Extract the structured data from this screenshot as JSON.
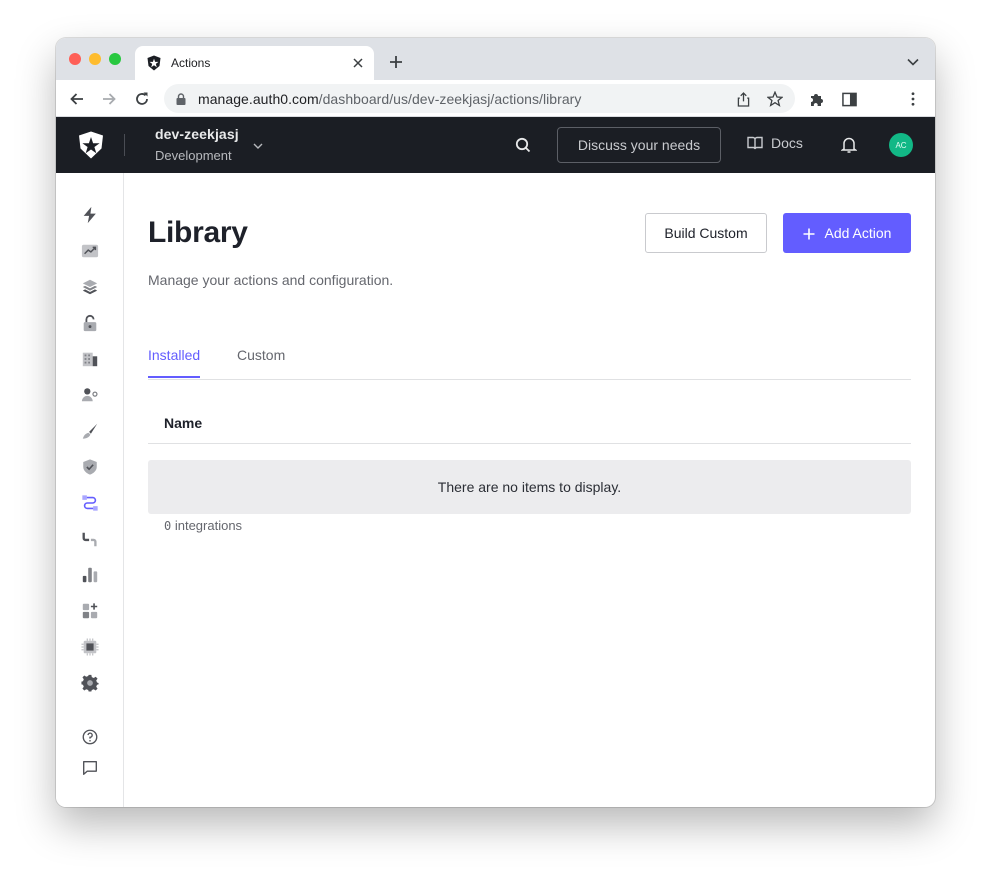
{
  "browser": {
    "tab": {
      "title": "Actions",
      "favicon": "auth0-shield-icon"
    },
    "url": {
      "host": "manage.auth0.com",
      "path": "/dashboard/us/dev-zeekjasj/actions/library"
    },
    "icons": [
      "back-icon",
      "forward-icon",
      "reload-icon",
      "lock-icon",
      "share-icon",
      "bookmark-star-icon",
      "extensions-icon",
      "side-panel-icon",
      "menu-kebab-icon",
      "new-tab-plus-icon",
      "tab-list-chevron-icon"
    ]
  },
  "header": {
    "tenant_name": "dev-zeekjasj",
    "tenant_env": "Development",
    "discuss_label": "Discuss your needs",
    "docs_label": "Docs",
    "avatar_initials": "AC",
    "avatar_color": "#12b886"
  },
  "sidebar": {
    "items": [
      {
        "name": "getting-started",
        "icon": "lightning-icon"
      },
      {
        "name": "activity",
        "icon": "trend-chart-icon"
      },
      {
        "name": "applications",
        "icon": "layers-icon"
      },
      {
        "name": "authentication",
        "icon": "unlock-icon"
      },
      {
        "name": "organizations",
        "icon": "building-icon"
      },
      {
        "name": "user-management",
        "icon": "user-gear-icon"
      },
      {
        "name": "branding",
        "icon": "brush-icon"
      },
      {
        "name": "security",
        "icon": "shield-check-icon"
      },
      {
        "name": "actions",
        "icon": "flow-icon",
        "active": true
      },
      {
        "name": "auth-pipeline",
        "icon": "pipe-icon"
      },
      {
        "name": "monitoring",
        "icon": "bar-chart-icon"
      },
      {
        "name": "marketplace",
        "icon": "apps-plus-icon"
      },
      {
        "name": "extensions",
        "icon": "chip-icon"
      },
      {
        "name": "settings",
        "icon": "gear-icon"
      }
    ],
    "bottom": [
      {
        "name": "help",
        "icon": "help-circle-icon"
      },
      {
        "name": "feedback",
        "icon": "chat-bubble-icon"
      }
    ],
    "accent": "#635dff"
  },
  "page": {
    "title": "Library",
    "subtitle": "Manage your actions and configuration.",
    "build_custom_label": "Build Custom",
    "add_action_label": "Add Action",
    "tabs": [
      {
        "label": "Installed",
        "active": true
      },
      {
        "label": "Custom",
        "active": false
      }
    ],
    "table": {
      "columns": [
        "Name"
      ],
      "rows": [],
      "empty_message": "There are no items to display."
    },
    "count_number": "0",
    "count_suffix": " integrations",
    "accent": "#635dff"
  }
}
